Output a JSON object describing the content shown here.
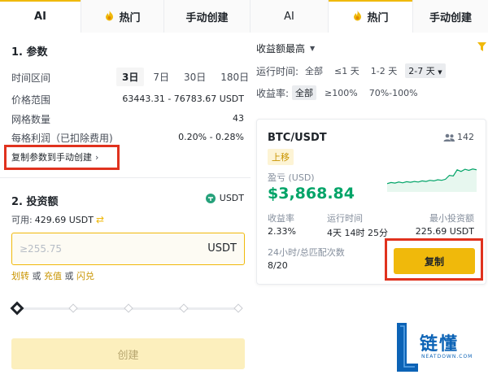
{
  "tabs": [
    {
      "label": "AI"
    },
    {
      "label": "热门"
    },
    {
      "label": "手动创建"
    },
    {
      "label": "AI"
    },
    {
      "label": "热门"
    },
    {
      "label": "手动创建"
    }
  ],
  "params": {
    "title": "1. 参数",
    "time_range_label": "时间区间",
    "time_options": [
      "3日",
      "7日",
      "30日",
      "180日"
    ],
    "time_selected": "3日",
    "price_range_label": "价格范围",
    "price_range_value": "63443.31 - 76783.67 USDT",
    "grid_count_label": "网格数量",
    "grid_count_value": "43",
    "profit_per_grid_label": "每格利润（已扣除费用)",
    "profit_per_grid_value": "0.20% - 0.28%",
    "copy_to_manual": "复制参数到手动创建"
  },
  "invest": {
    "title": "2. 投资额",
    "currency": "USDT",
    "available_label": "可用:",
    "available_value": "429.69 USDT",
    "input_placeholder": "≥255.75",
    "input_unit": "USDT",
    "links": {
      "transfer": "划转",
      "or1": "或",
      "deposit": "充值",
      "or2": "或",
      "flash": "闪兑"
    },
    "slider_percent": 0,
    "create_label": "创建"
  },
  "filters": {
    "sort_label": "收益额最高",
    "run_time_label": "运行时间:",
    "run_time_options": [
      "全部",
      "≤1 天",
      "1-2 天",
      "2-7 天"
    ],
    "run_time_selected": "2-7 天",
    "yield_label": "收益率:",
    "yield_options": [
      "全部",
      "≥100%",
      "70%-100%"
    ],
    "yield_selected": "全部"
  },
  "card": {
    "pair": "BTC/USDT",
    "users": "142",
    "trend": "上移",
    "pnl_label": "盈亏 (USD)",
    "pnl_value": "$3,868.84",
    "yield_label": "收益率",
    "yield_value": "2.33%",
    "runtime_label": "运行时间",
    "runtime_value": "4天 14时 25分",
    "min_invest_label": "最小投资额",
    "min_invest_value": "225.69 USDT",
    "match_label": "24小时/总匹配次数",
    "match_value": "8/20",
    "copy_label": "复制",
    "spark": [
      0.3,
      0.34,
      0.32,
      0.36,
      0.33,
      0.37,
      0.35,
      0.38,
      0.36,
      0.4,
      0.38,
      0.42,
      0.4,
      0.44,
      0.42,
      0.46,
      0.6,
      0.58,
      0.8,
      0.74,
      0.82,
      0.78,
      0.83,
      0.8
    ]
  },
  "logo": {
    "text": "链懂",
    "sub": "NEATDOWN.COM"
  },
  "colors": {
    "accent": "#f0b90b",
    "positive": "#02a468",
    "annotation": "#e0321e"
  }
}
